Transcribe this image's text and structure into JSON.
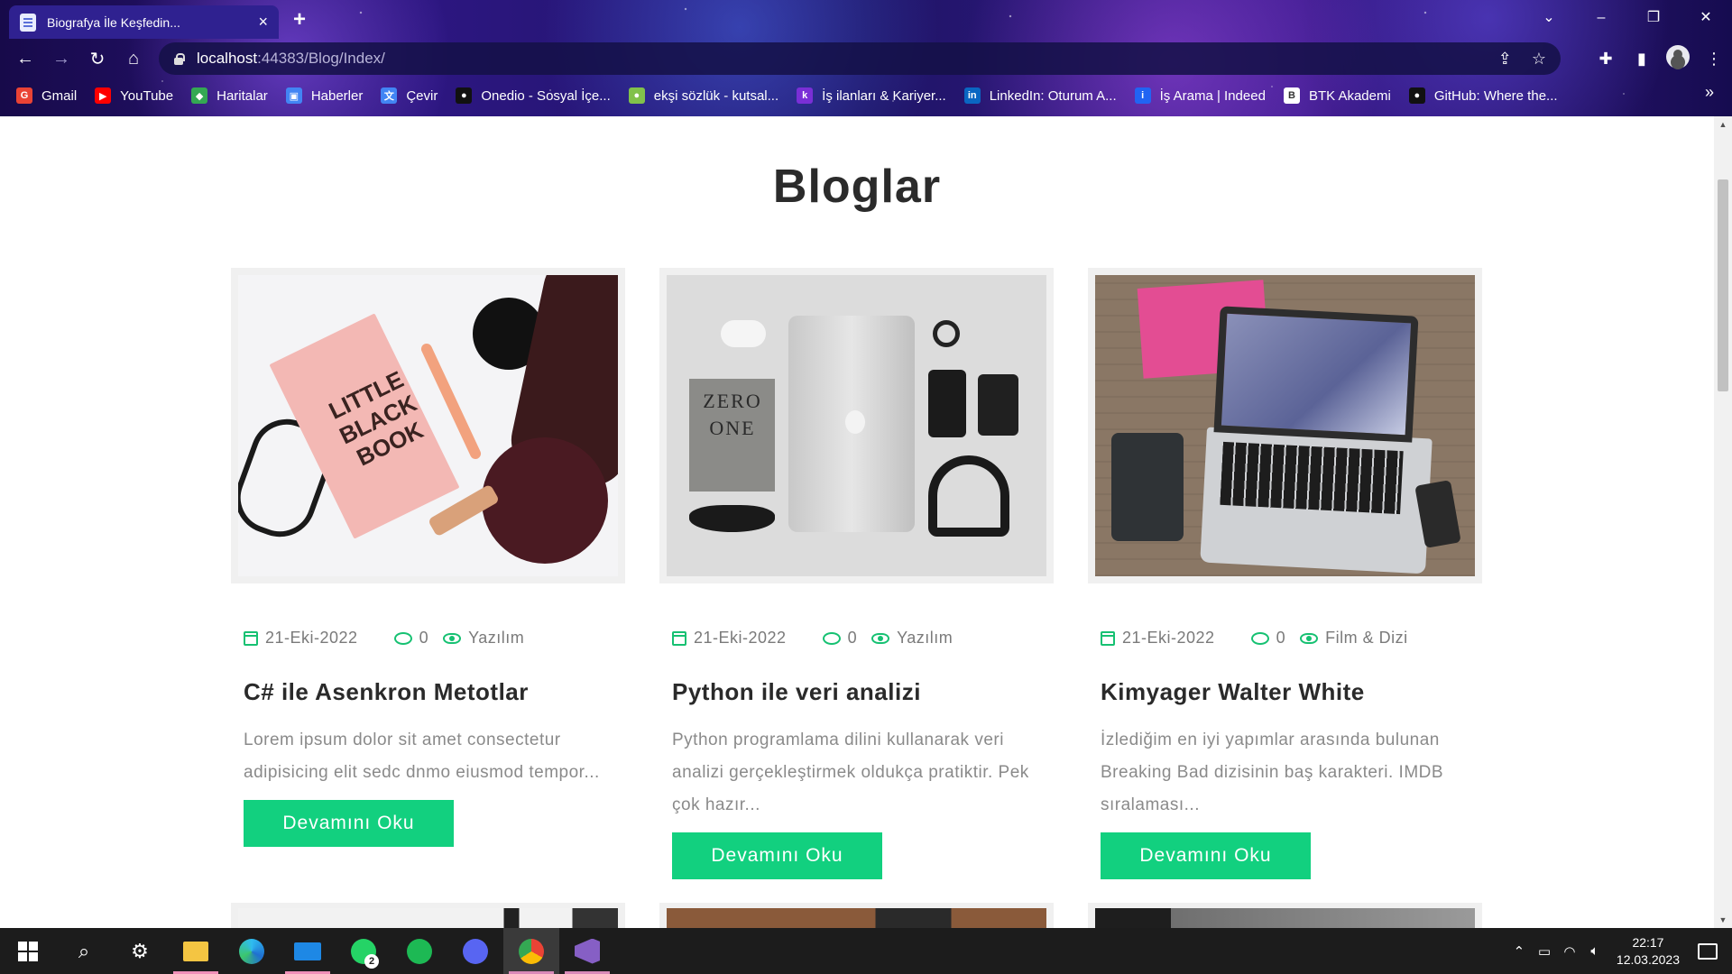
{
  "browser": {
    "tab_title": "Biografya İle Keşfedin...",
    "tab_close": "×",
    "new_tab": "+",
    "url_host": "localhost",
    "url_path": ":44383/Blog/Index/",
    "bookmarks": [
      {
        "label": "Gmail",
        "icon": "gmail-icon",
        "color": "#ea4335",
        "glyph": "G"
      },
      {
        "label": "YouTube",
        "icon": "youtube-icon",
        "color": "#ff0000",
        "glyph": "▶"
      },
      {
        "label": "Haritalar",
        "icon": "maps-icon",
        "color": "#34a853",
        "glyph": "◆"
      },
      {
        "label": "Haberler",
        "icon": "news-icon",
        "color": "#4285f4",
        "glyph": "▣"
      },
      {
        "label": "Çevir",
        "icon": "translate-icon",
        "color": "#4285f4",
        "glyph": "文"
      },
      {
        "label": "Onedio - Sosyal İçe...",
        "icon": "onedio-icon",
        "color": "#111111",
        "glyph": "●"
      },
      {
        "label": "ekşi sözlük - kutsal...",
        "icon": "eksi-icon",
        "color": "#81c14b",
        "glyph": "●"
      },
      {
        "label": "İş ilanları & Kariyer...",
        "icon": "kariyer-icon",
        "color": "#7a2fd6",
        "glyph": "k"
      },
      {
        "label": "LinkedIn: Oturum A...",
        "icon": "linkedin-icon",
        "color": "#0a66c2",
        "glyph": "in"
      },
      {
        "label": "İş Arama | Indeed",
        "icon": "indeed-icon",
        "color": "#2164f3",
        "glyph": "i"
      },
      {
        "label": "BTK Akademi",
        "icon": "btk-icon",
        "color": "#ffffff",
        "glyph": "B"
      },
      {
        "label": "GitHub: Where the...",
        "icon": "github-icon",
        "color": "#111111",
        "glyph": "●"
      }
    ],
    "more": "»"
  },
  "page": {
    "title": "Bloglar",
    "read_more": "Devamını Oku",
    "posts": [
      {
        "date": "21-Eki-2022",
        "comments": "0",
        "category": "Yazılım",
        "title": "C# ile Asenkron Metotlar",
        "excerpt": "Lorem ipsum dolor sit amet consectetur adipisicing elit sedc dnmo eiusmod tempor...",
        "book_text": "LITTLE BLACK BOOK"
      },
      {
        "date": "21-Eki-2022",
        "comments": "0",
        "category": "Yazılım",
        "title": "Python ile veri analizi",
        "excerpt": "Python programlama dilini kullanarak veri analizi gerçekleştirmek oldukça pratiktir. Pek çok hazır...",
        "book_text": "ZERO ONE"
      },
      {
        "date": "21-Eki-2022",
        "comments": "0",
        "category": "Film & Dizi",
        "title": "Kimyager Walter White",
        "excerpt": "İzlediğim en iyi yapımlar arasında bulunan Breaking Bad dizisinin baş karakteri. IMDB sıralaması..."
      }
    ]
  },
  "taskbar": {
    "whatsapp_badge": "2",
    "time": "22:17",
    "date": "12.03.2023"
  },
  "colors": {
    "accent": "#12d07f",
    "title": "#2b2b2b"
  }
}
